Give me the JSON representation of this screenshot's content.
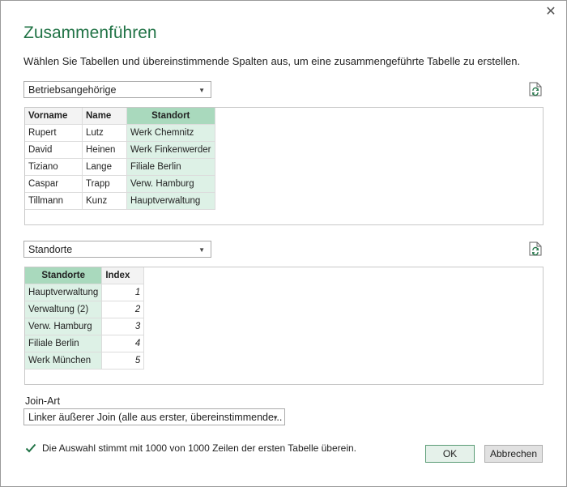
{
  "dialog": {
    "title": "Zusammenführen",
    "subtitle": "Wählen Sie Tabellen und übereinstimmende Spalten aus, um eine zusammengeführte Tabelle zu erstellen.",
    "close_glyph": "✕"
  },
  "table1": {
    "selected": "Betriebsangehörige",
    "headers": [
      "Vorname",
      "Name",
      "Standort"
    ],
    "rows": [
      [
        "Rupert",
        "Lutz",
        "Werk Chemnitz"
      ],
      [
        "David",
        "Heinen",
        "Werk Finkenwerder"
      ],
      [
        "Tiziano",
        "Lange",
        "Filiale Berlin"
      ],
      [
        "Caspar",
        "Trapp",
        "Verw. Hamburg"
      ],
      [
        "Tillmann",
        "Kunz",
        "Hauptverwaltung"
      ]
    ],
    "selected_column": "Standort"
  },
  "table2": {
    "selected": "Standorte",
    "headers": [
      "Standorte",
      "Index"
    ],
    "rows": [
      [
        "Hauptverwaltung",
        "1"
      ],
      [
        "Verwaltung (2)",
        "2"
      ],
      [
        "Verw. Hamburg",
        "3"
      ],
      [
        "Filiale Berlin",
        "4"
      ],
      [
        "Werk München",
        "5"
      ]
    ],
    "selected_column": "Standorte"
  },
  "join": {
    "label": "Join-Art",
    "selected": "Linker äußerer Join (alle aus erster, übereinstimmende..."
  },
  "status": {
    "text": "Die Auswahl stimmt mit 1000 von 1000 Zeilen der ersten Tabelle überein."
  },
  "buttons": {
    "ok": "OK",
    "cancel": "Abbrechen"
  },
  "colors": {
    "accent": "#217346",
    "selected_header": "#a9d9bd",
    "selected_cell": "#ddf1e6"
  },
  "icons": {
    "close": "close-icon",
    "refresh": "refresh-icon",
    "dropdown": "chevron-down-icon",
    "status": "checkmark-icon"
  }
}
